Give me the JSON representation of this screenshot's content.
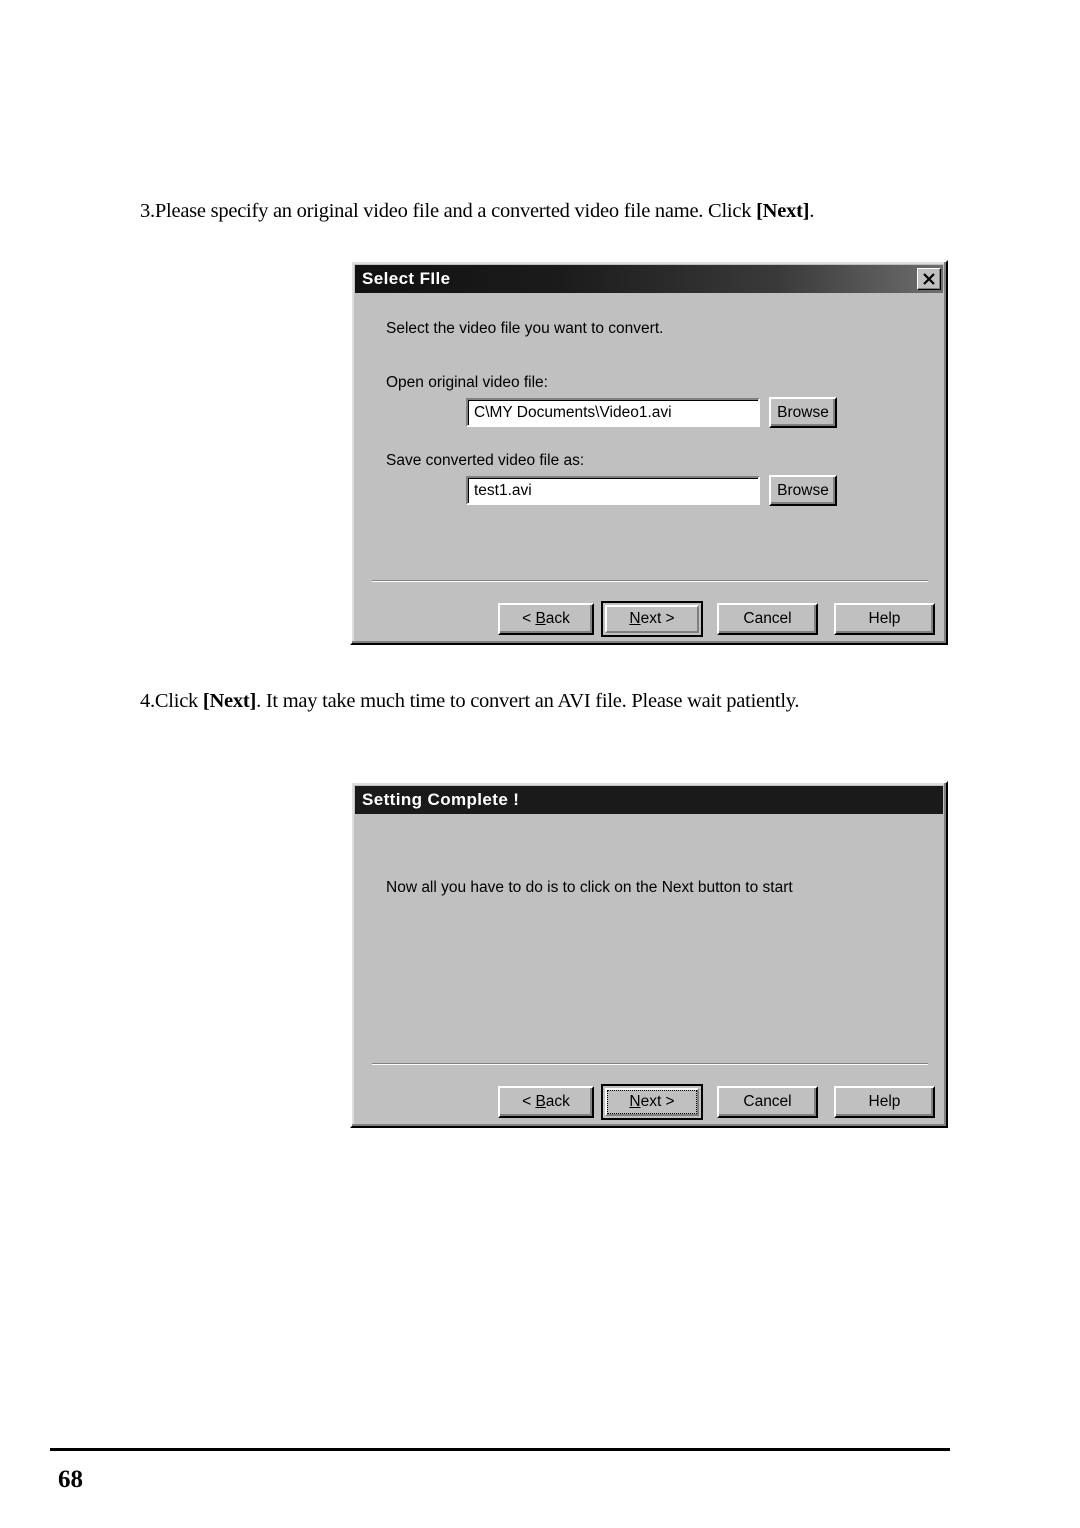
{
  "page": {
    "number": "68"
  },
  "instructions": [
    {
      "id": "step3",
      "prefix": "3.Please specify an original video file and a converted video file name. Click ",
      "emphasis": "[Next]",
      "suffix": "."
    },
    {
      "id": "step4",
      "prefix": "4.Click ",
      "emphasis": "[Next]",
      "suffix": ". It may take much time to convert an AVI file. Please wait patiently."
    }
  ],
  "dialog_select_file": {
    "title": "Select FIle",
    "close_icon": "close-icon",
    "intro_text": "Select the video file you want to convert.",
    "field_open_label": "Open original video file:",
    "field_open_value": "C\\MY Documents\\Video1.avi",
    "browse_open_label": "Browse",
    "field_save_label": "Save converted video file as:",
    "field_save_value": "test1.avi",
    "browse_save_label": "Browse",
    "buttons": {
      "back_pre": "< ",
      "back_accel": "B",
      "back_post": "ack",
      "next_accel": "N",
      "next_post": "ext >",
      "cancel": "Cancel",
      "help": "Help"
    }
  },
  "dialog_setting_complete": {
    "title": "Setting Complete !",
    "body_text": "Now all you have to do is to click on the Next button to start",
    "buttons": {
      "back_pre": "< ",
      "back_accel": "B",
      "back_post": "ack",
      "next_accel": "N",
      "next_post": "ext >",
      "cancel": "Cancel",
      "help": "Help"
    }
  },
  "colors": {
    "dialog_face": "#c0c0c0",
    "titlebar_dark": "#1a1a1a",
    "titlebar_light": "#6e6e6e",
    "field_background": "#ffffff",
    "text": "#000000"
  }
}
